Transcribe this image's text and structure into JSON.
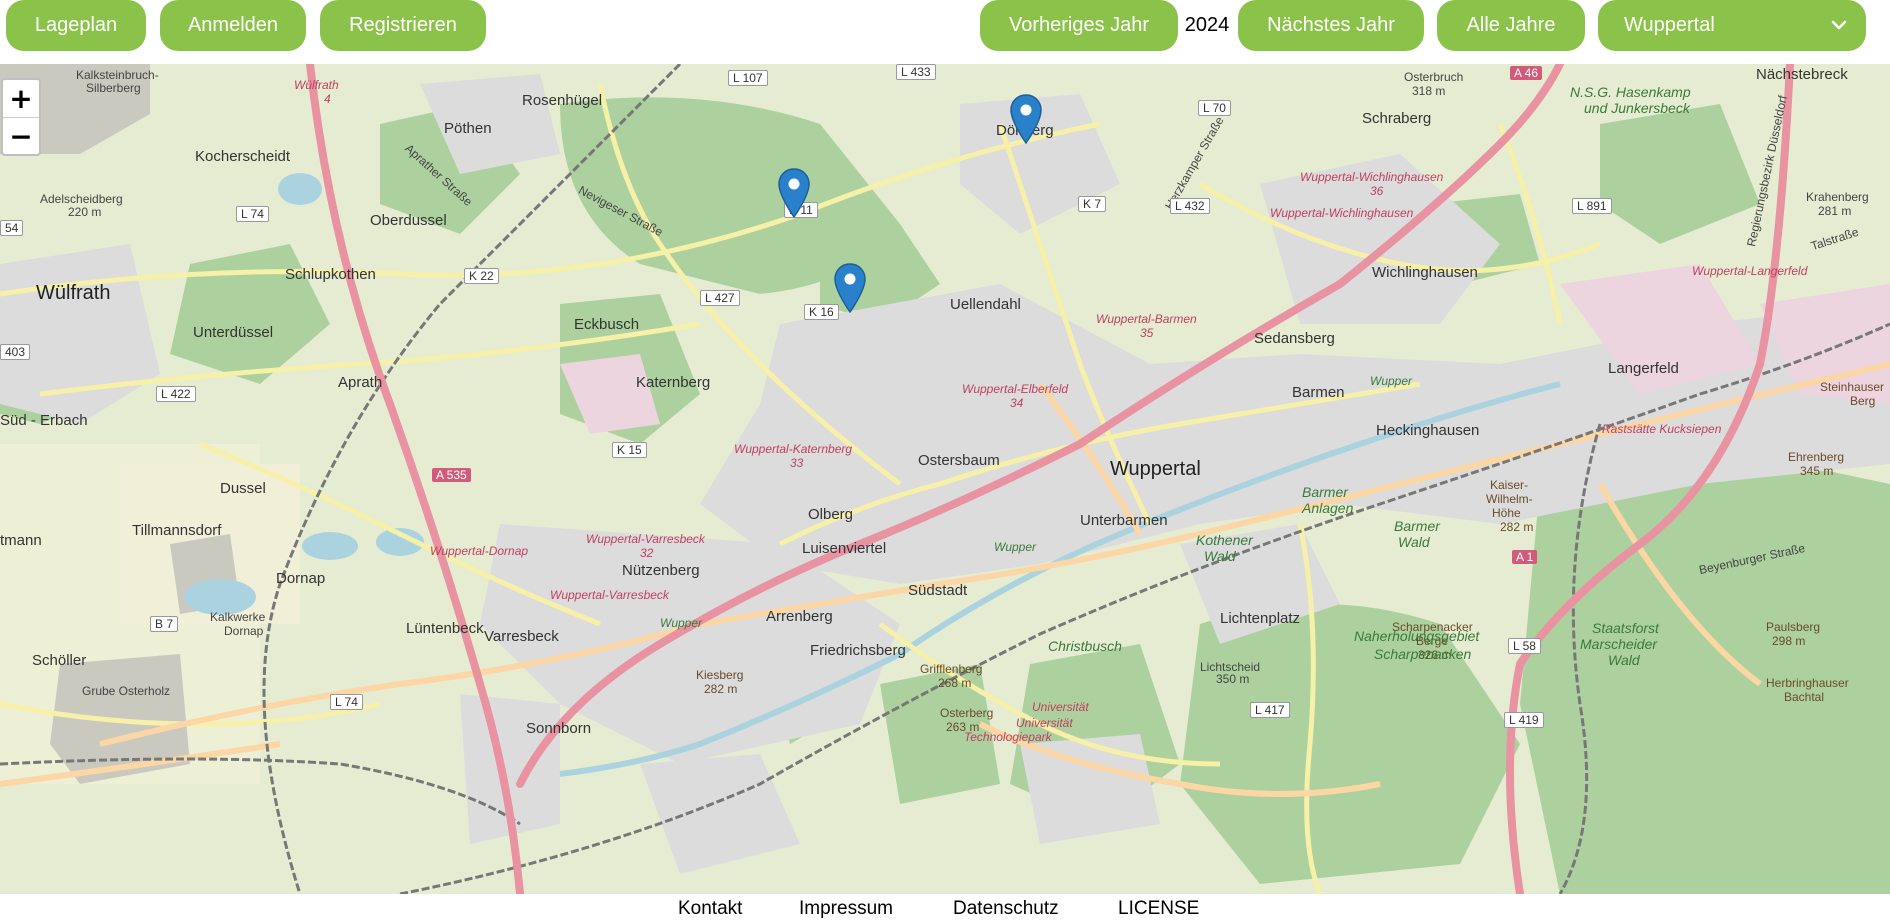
{
  "header": {
    "buttons": {
      "lageplan": "Lageplan",
      "anmelden": "Anmelden",
      "registrieren": "Registrieren",
      "prev_year": "Vorheriges Jahr",
      "next_year": "Nächstes Jahr",
      "all_years": "Alle Jahre"
    },
    "year": "2024",
    "city_select": {
      "value": "Wuppertal"
    }
  },
  "map": {
    "zoom": {
      "in": "+",
      "out": "−"
    },
    "markers": [
      {
        "name": "marker-doenberg",
        "icon": "map-pin-icon"
      },
      {
        "name": "marker-k11",
        "icon": "map-pin-icon"
      },
      {
        "name": "marker-k16",
        "icon": "map-pin-icon"
      }
    ],
    "labels": {
      "wuelfrath": "Wülfrath",
      "kalksteinbruch": "Kalksteinbruch-",
      "silberberg": "Silberberg",
      "kocherscheidt": "Kocherscheidt",
      "adelscheidberg": "Adelscheidberg",
      "adelscheidberg_m": "220 m",
      "poethen": "Pöthen",
      "rosenhuegel": "Rosenhügel",
      "oberdussel": "Oberdussel",
      "schlupkothen": "Schlupkothen",
      "unterduessel": "Unterdüssel",
      "eckbusch": "Eckbusch",
      "aprath": "Aprath",
      "katernberg": "Katernberg",
      "sued_erbach": "Süd - Erbach",
      "dussel": "Dussel",
      "tillmannsdorf": "Tillmannsdorf",
      "tmann": "tmann",
      "dornap": "Dornap",
      "luentenbeck": "Lüntenbeck",
      "varresbeck": "Varresbeck",
      "schoeller": "Schöller",
      "grube_osterholz": "Grube Osterholz",
      "sonnborn": "Sonnborn",
      "kalkwerke": "Kalkwerke",
      "kalkwerke_dornap": "Dornap",
      "doenberg": "Dönberg",
      "uellendahl": "Uellendahl",
      "ostersbaum": "Ostersbaum",
      "olberg": "Olberg",
      "luisenviertel": "Luisenviertel",
      "nuetzenberg": "Nützenberg",
      "arrenberg": "Arrenberg",
      "suedstadt": "Südstadt",
      "friedrichsberg": "Friedrichsberg",
      "wuppertal": "Wuppertal",
      "unterbarmen": "Unterbarmen",
      "barmen": "Barmen",
      "sedansberg": "Sedansberg",
      "heckinghausen": "Heckinghausen",
      "wichlinghausen": "Wichlinghausen",
      "schraberg": "Schraberg",
      "osterbruch": "Osterbruch",
      "osterbruch_m": "318 m",
      "naechstebreck": "Nächstebreck",
      "langerfeld": "Langerfeld",
      "krahenberg": "Krahenberg",
      "krahenberg_m": "281 m",
      "lichtenplatz": "Lichtenplatz",
      "lichtscheid": "Lichtscheid",
      "lichtscheid_m": "350 m",
      "griffenberg": "Grifflenberg",
      "griffenberg_m": "268 m",
      "osterberg": "Osterberg",
      "osterberg_m": "263 m",
      "kiesberg": "Kiesberg",
      "kiesberg_m": "282 m",
      "kaiser_wilhelm": "Kaiser-",
      "kaiser_wilhelm2": "Wilhelm-",
      "kaiser_wilhelm3": "Höhe",
      "kaiser_wilhelm_m": "282 m",
      "scharpenacker": "Scharpenacker",
      "scharpenacker2": "Berge",
      "scharpenacker_m": "326 m",
      "naherholung": "Naherholungsgebiet",
      "naherholung2": "Scharpenacken",
      "staatsforst": "Staatsforst",
      "staatsforst2": "Marscheider",
      "staatsforst3": "Wald",
      "paulsberg": "Paulsberg",
      "paulsberg_m": "298 m",
      "ehrenberg": "Ehrenberg",
      "ehrenberg_m": "345 m",
      "steinhauser": "Steinhauser",
      "steinhauser2": "Berg",
      "herbringhauser": "Herbringhauser",
      "herbringhauser2": "Bachtal",
      "barmer_anlagen": "Barmer",
      "barmer_anlagen2": "Anlagen",
      "barmer_wald": "Barmer",
      "barmer_wald2": "Wald",
      "kothener_wald": "Kothener",
      "kothener_wald2": "Wald",
      "christbusch": "Christbusch",
      "nsg": "N.S.G. Hasenkamp",
      "nsg2": "und Junkersbeck",
      "universitaet": "Universität",
      "universitaet2": "Universität",
      "technologiepark": "Technologiepark",
      "hw_katernberg": "Wuppertal-Katernberg",
      "hw_katernberg_n": "33",
      "hw_elberfeld": "Wuppertal-Elberfeld",
      "hw_elberfeld_n": "34",
      "hw_barmen": "Wuppertal-Barmen",
      "hw_barmen_n": "35",
      "hw_wichlinghausen": "Wuppertal-Wichlinghausen",
      "hw_wichlinghausen_n": "36",
      "hw_wichlinghausen2": "Wuppertal-Wichlinghausen",
      "hw_langerfeld": "Wuppertal-Langerfeld",
      "hw_varresbeck": "Wuppertal-Varresbeck",
      "hw_varresbeck_n": "32",
      "hw_varresbeck2": "Wuppertal-Varresbeck",
      "hw_dornap": "Wuppertal-Dornap",
      "hw_wuelfrath": "Wülfrath",
      "hw_wuelfrath_n": "4",
      "raststaette": "Raststätte Kucksiepen",
      "wupper": "Wupper",
      "wupper2": "Wupper",
      "wupper3": "Wupper",
      "neviges_strasse": "Nevigeser Straße",
      "aprather_strasse": "Aprather Straße",
      "herzkamper_strasse": "Herzkamper Straße",
      "regierungsbezirk": "Regierungsbezirk Düsseldorf",
      "talstrasse": "Talstraße",
      "beyenburger": "Beyenburger Straße",
      "r_l107": "L 107",
      "r_l433": "L 433",
      "r_l70": "L 70",
      "r_a46": "A 46",
      "r_l74": "L 74",
      "r_k22": "K 22",
      "r_l427": "L 427",
      "r_k16": "K 16",
      "r_k11": "K 11",
      "r_k7": "K 7",
      "r_l432": "L 432",
      "r_l891": "L 891",
      "r_403": "403",
      "r_l422": "L 422",
      "r_k15": "K 15",
      "r_a535": "A 535",
      "r_b7": "B 7",
      "r_l74b": "L 74",
      "r_l417": "L 417",
      "r_l419": "L 419",
      "r_a1": "A 1",
      "r_l58": "L 58",
      "r_54": "54"
    }
  },
  "footer": {
    "kontakt": "Kontakt",
    "impressum": "Impressum",
    "datenschutz": "Datenschutz",
    "license": "LICENSE"
  },
  "colors": {
    "button": "#8bc34a",
    "marker": "#2a81cb",
    "motorway": "#e892a2",
    "primary_road": "#fcd6a4",
    "forest": "#add19e",
    "urban": "#dddddd",
    "water": "#aad3df"
  }
}
